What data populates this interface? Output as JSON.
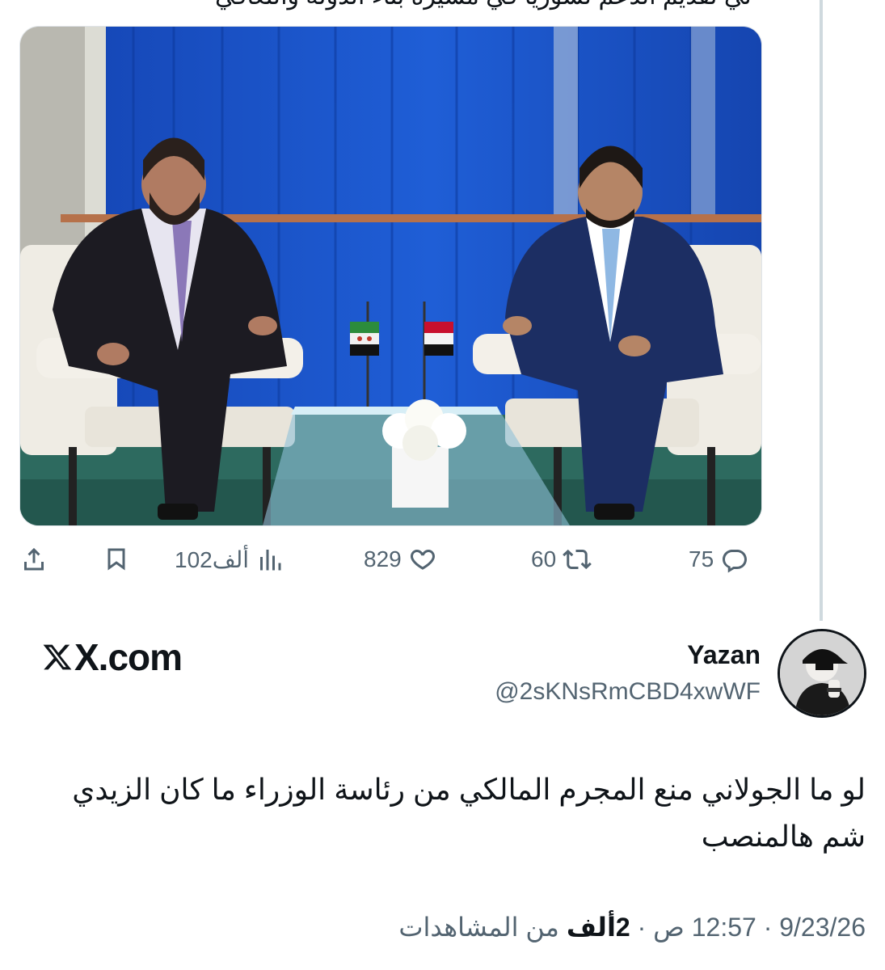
{
  "previous_tweet": {
    "truncated_text_line": "لي تقديم الدعم لسوريا في مسيرة بناء الدولة والتعافي",
    "actions": {
      "replies": "75",
      "reposts": "60",
      "likes": "829",
      "views": "102ألف"
    }
  },
  "watermark": {
    "site": "X.com"
  },
  "tweet": {
    "author_name": "Yazan",
    "author_handle": "@2sKNsRmCBD4xwWF",
    "text": "لو ما الجولاني منع المجرم المالكي من رئاسة الوزراء ما كان الزيدي شم هالمنصب",
    "date": "9/23/26",
    "time": "12:57 ص",
    "views_count": "2ألف",
    "views_label": "من المشاهدات",
    "separator": "·"
  },
  "colors": {
    "text_primary": "#0f1419",
    "text_secondary": "#536471",
    "thread_line": "#cfd9de",
    "curtain_blue": "#1a55c8"
  },
  "icons": [
    "share-icon",
    "bookmark-icon",
    "views-chart-icon",
    "like-heart-icon",
    "repost-icon",
    "reply-icon",
    "x-logo-icon"
  ]
}
